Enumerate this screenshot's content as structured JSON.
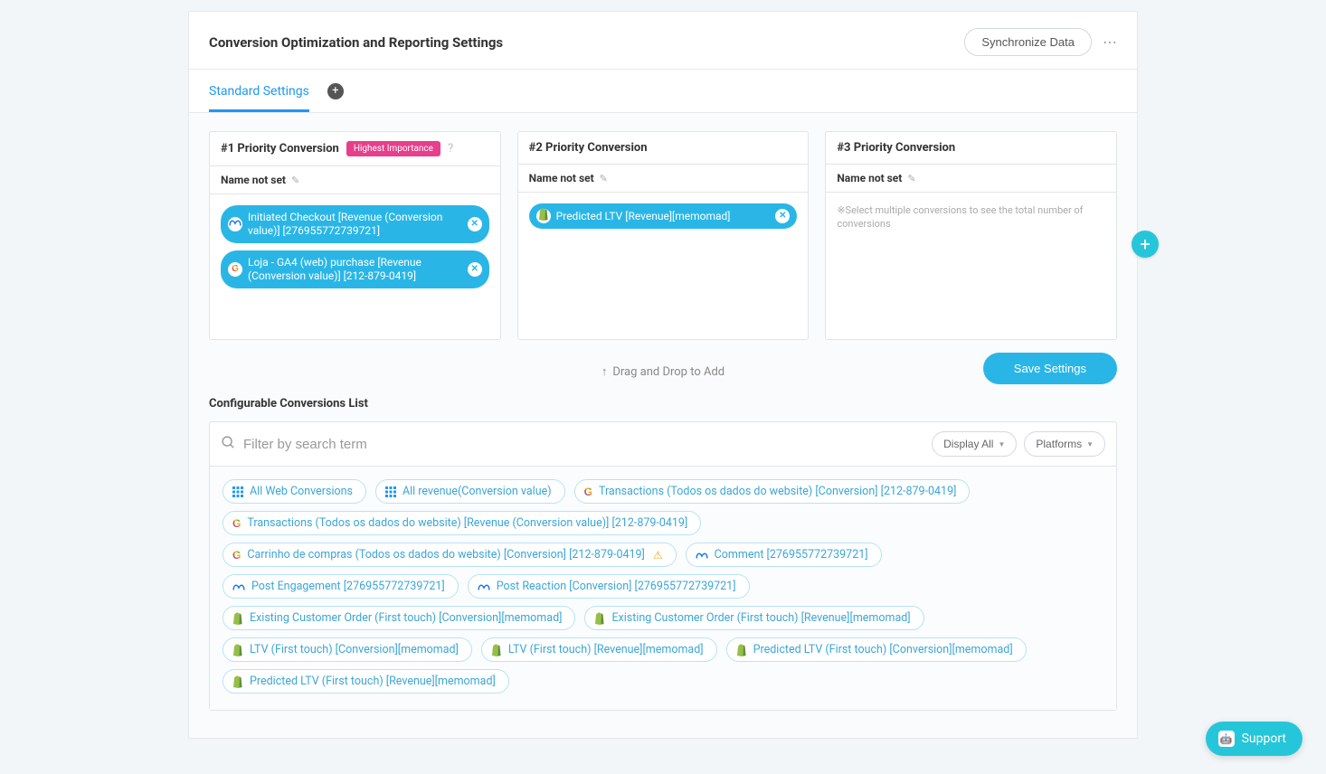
{
  "header": {
    "title": "Conversion Optimization and Reporting Settings",
    "sync_label": "Synchronize Data"
  },
  "tabs": {
    "standard": "Standard Settings"
  },
  "priority": {
    "heading_prefix": "#",
    "heading_suffix": " Priority Conversion",
    "badge": "Highest Importance",
    "name_not_set": "Name not set",
    "placeholder": "※Select multiple conversions to see the total number of conversions",
    "cols": [
      {
        "label": "#1 Priority Conversion",
        "chips": [
          {
            "platform": "meta",
            "text": "Initiated Checkout [Revenue (Conversion value)] [276955772739721]"
          },
          {
            "platform": "google",
            "text": "Loja - GA4 (web) purchase [Revenue (Conversion value)] [212-879-0419]"
          }
        ]
      },
      {
        "label": "#2 Priority Conversion",
        "chips": [
          {
            "platform": "shopify",
            "text": "Predicted LTV [Revenue][memomad]"
          }
        ]
      },
      {
        "label": "#3 Priority Conversion",
        "chips": []
      }
    ]
  },
  "actions": {
    "save": "Save Settings",
    "drag_hint": "Drag and Drop to Add"
  },
  "list": {
    "title": "Configurable Conversions List",
    "filter_placeholder": "Filter by search term",
    "display_all": "Display All",
    "platforms": "Platforms",
    "chips": [
      {
        "platform": "grid",
        "text": "All Web Conversions"
      },
      {
        "platform": "grid",
        "text": "All revenue(Conversion value)"
      },
      {
        "platform": "google",
        "text": "Transactions (Todos os dados do website) [Conversion] [212-879-0419]"
      },
      {
        "platform": "google",
        "text": "Transactions (Todos os dados do website) [Revenue (Conversion value)] [212-879-0419]"
      },
      {
        "platform": "google",
        "text": "Carrinho de compras (Todos os dados do website) [Conversion] [212-879-0419]",
        "warn": true
      },
      {
        "platform": "meta",
        "text": "Comment [276955772739721]"
      },
      {
        "platform": "meta",
        "text": "Post Engagement [276955772739721]"
      },
      {
        "platform": "meta",
        "text": "Post Reaction [Conversion] [276955772739721]"
      },
      {
        "platform": "shopify",
        "text": "Existing Customer Order (First touch) [Conversion][memomad]"
      },
      {
        "platform": "shopify",
        "text": "Existing Customer Order (First touch) [Revenue][memomad]"
      },
      {
        "platform": "shopify",
        "text": "LTV (First touch) [Conversion][memomad]"
      },
      {
        "platform": "shopify",
        "text": "LTV (First touch) [Revenue][memomad]"
      },
      {
        "platform": "shopify",
        "text": "Predicted LTV (First touch) [Conversion][memomad]"
      },
      {
        "platform": "shopify",
        "text": "Predicted LTV (First touch) [Revenue][memomad]"
      }
    ]
  },
  "support": {
    "label": "Support"
  }
}
